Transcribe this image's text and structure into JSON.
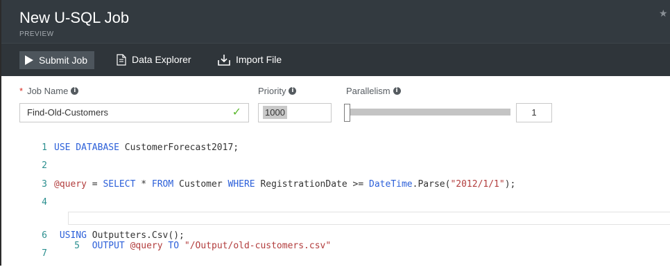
{
  "blade": {
    "title": "New U-SQL Job",
    "subtitle": "PREVIEW"
  },
  "toolbar": {
    "submit_label": "Submit Job",
    "explorer_label": "Data Explorer",
    "import_label": "Import File"
  },
  "form": {
    "job_name": {
      "label": "Job Name",
      "required_mark": "*",
      "value": "Find-Old-Customers",
      "valid": true
    },
    "priority": {
      "label": "Priority",
      "value": "1000"
    },
    "parallelism": {
      "label": "Parallelism",
      "value": "1",
      "slider_fraction": 0.0
    }
  },
  "editor": {
    "lines": [
      {
        "num": "1",
        "text": "USE DATABASE CustomerForecast2017;"
      },
      {
        "num": "2",
        "text": ""
      },
      {
        "num": "3",
        "text": "@query = SELECT * FROM Customer WHERE RegistrationDate >= DateTime.Parse(\"2012/1/1\");"
      },
      {
        "num": "4",
        "text": ""
      },
      {
        "num": "5",
        "text": " OUTPUT @query TO \"/Output/old-customers.csv\""
      },
      {
        "num": "6",
        "text": " USING Outputters.Csv();"
      },
      {
        "num": "7",
        "text": ""
      }
    ]
  },
  "colors": {
    "header_bg": "#333a40",
    "toolbar_bg": "#2f353a",
    "keyword": "#2b5fd9",
    "string": "#b23c3c",
    "line_number": "#2b8f8f",
    "valid_check": "#5cb82f"
  }
}
